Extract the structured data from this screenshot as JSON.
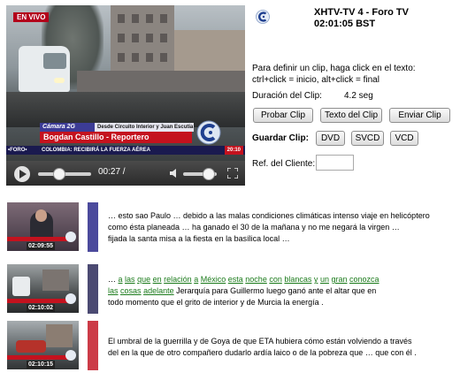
{
  "player": {
    "live_badge": "EN VIVO",
    "lower_third": {
      "camera": "Cámara 2G",
      "location": "Desde Circuito Interior y Juan Escutia",
      "reporter": "Bogdan Castillo - Reportero"
    },
    "ticker": {
      "left": "•FORO•",
      "text": "COLOMBIA: RECIBIRÁ LA FUERZA AÉREA",
      "clock": "20:10"
    },
    "time_display": "00:27 /",
    "progress_fraction": 0.28,
    "volume_fraction": 0.6,
    "icons": {
      "play": "play-icon",
      "volume": "volume-icon",
      "fullscreen": "fullscreen-icon",
      "channel_logo": "channel-logo-icon"
    }
  },
  "header": {
    "station_line1": "XHTV-TV 4 - Foro TV",
    "station_line2": "02:01:05 BST"
  },
  "instructions": {
    "line1": "Para definir un clip, haga click en el texto:",
    "line2": "ctrl+click = inicio, alt+click = final"
  },
  "duration": {
    "label": "Duración del Clip:",
    "value": "4.2 seg"
  },
  "buttons": {
    "probar": "Probar Clip",
    "texto": "Texto del Clip",
    "enviar": "Enviar Clip"
  },
  "save": {
    "label": "Guardar Clip:",
    "dvd": "DVD",
    "svcd": "SVCD",
    "vcd": "VCD"
  },
  "reference": {
    "label": "Ref. del Cliente:",
    "value": ""
  },
  "clips": [
    {
      "timestamp": "02:09:55",
      "bar_color": "#4b4a9c",
      "lines": [
        [
          {
            "text": "… esto sao Paulo … debido a las malas condiciones climáticas intenso viaje en helicóptero",
            "link": false
          }
        ],
        [
          {
            "text": "como ésta planeada … ha ganado el 30 de la mañana y no me negará la virgen …",
            "link": false
          }
        ],
        [
          {
            "text": "fijada la santa misa a la fiesta en la basílica local …",
            "link": false
          }
        ]
      ]
    },
    {
      "timestamp": "02:10:02",
      "bar_color": "#4b4a72",
      "lines": [
        [
          {
            "text": "… ",
            "link": false
          },
          {
            "text": "a",
            "link": true
          },
          {
            "text": " ",
            "link": false
          },
          {
            "text": "las",
            "link": true
          },
          {
            "text": " ",
            "link": false
          },
          {
            "text": "que",
            "link": true
          },
          {
            "text": " ",
            "link": false
          },
          {
            "text": "en",
            "link": true
          },
          {
            "text": " ",
            "link": false
          },
          {
            "text": "relación",
            "link": true
          },
          {
            "text": " ",
            "link": false
          },
          {
            "text": "a",
            "link": true
          },
          {
            "text": " ",
            "link": false
          },
          {
            "text": "México",
            "link": true
          },
          {
            "text": " ",
            "link": false
          },
          {
            "text": "esta",
            "link": true
          },
          {
            "text": " ",
            "link": false
          },
          {
            "text": "noche",
            "link": true
          },
          {
            "text": " ",
            "link": false
          },
          {
            "text": "con",
            "link": true
          },
          {
            "text": " ",
            "link": false
          },
          {
            "text": "blancas",
            "link": true
          },
          {
            "text": " ",
            "link": false
          },
          {
            "text": "y",
            "link": true
          },
          {
            "text": " ",
            "link": false
          },
          {
            "text": "un",
            "link": true
          },
          {
            "text": " ",
            "link": false
          },
          {
            "text": "gran",
            "link": true
          },
          {
            "text": " ",
            "link": false
          },
          {
            "text": "conozca",
            "link": true
          }
        ],
        [
          {
            "text": "las",
            "link": true
          },
          {
            "text": " ",
            "link": false
          },
          {
            "text": "cosas",
            "link": true
          },
          {
            "text": " ",
            "link": false
          },
          {
            "text": "adelante",
            "link": true
          },
          {
            "text": "  Jerarquía para Guillermo luego ganó ante el altar que en",
            "link": false
          }
        ],
        [
          {
            "text": "todo momento que el grito de interior y de Murcia la energía .",
            "link": false
          }
        ]
      ]
    },
    {
      "timestamp": "02:10:15",
      "bar_color": "#cc3b47",
      "lines": [
        [
          {
            "text": "El umbral de la guerrilla y de Goya de que ETA hubiera cómo están volviendo a través",
            "link": false
          }
        ],
        [
          {
            "text": "del en la que de otro compañero dudarlo ardía laico o de la pobreza que … que con él .",
            "link": false
          }
        ]
      ]
    }
  ]
}
